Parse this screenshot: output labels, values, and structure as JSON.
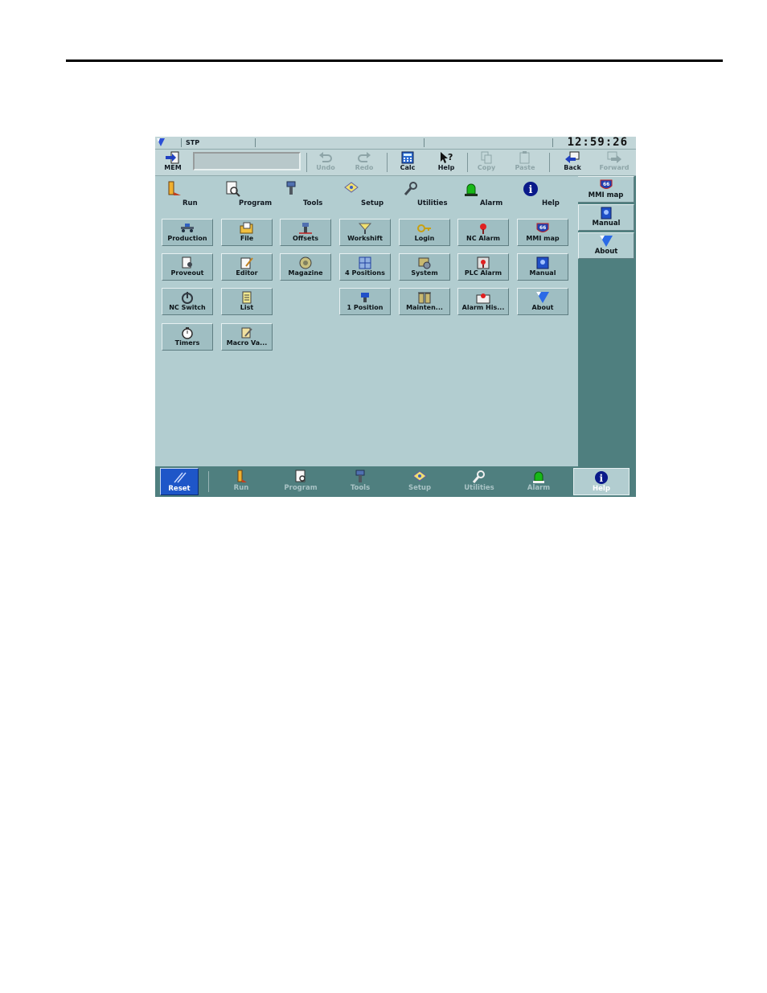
{
  "status": {
    "mode": "STP",
    "time": "12:59:26"
  },
  "toolbar": {
    "mem": "MEM",
    "undo": "Undo",
    "redo": "Redo",
    "calc": "Calc",
    "help": "Help",
    "copy": "Copy",
    "paste": "Paste",
    "back": "Back",
    "forward": "Forward"
  },
  "categories": [
    "Run",
    "Program",
    "Tools",
    "Setup",
    "Utilities",
    "Alarm",
    "Help"
  ],
  "grid": {
    "production": "Production",
    "file": "File",
    "offsets": "Offsets",
    "workshift": "Workshift",
    "login": "Login",
    "nc_alarm": "NC Alarm",
    "mmi_map": "MMI map",
    "proveout": "Proveout",
    "editor": "Editor",
    "magazine": "Magazine",
    "four_positions": "4 Positions",
    "system": "System",
    "plc_alarm": "PLC Alarm",
    "manual": "Manual",
    "nc_switch": "NC Switch",
    "list": "List",
    "one_position": "1 Position",
    "mainten": "Mainten...",
    "alarm_his": "Alarm His...",
    "about": "About",
    "timers": "Timers",
    "macro_va": "Macro Va..."
  },
  "right_panel": {
    "mmi_map": "MMI map",
    "manual": "Manual",
    "about": "About"
  },
  "bottom": {
    "reset": "Reset",
    "run": "Run",
    "program": "Program",
    "tools": "Tools",
    "setup": "Setup",
    "utilities": "Utilities",
    "alarm": "Alarm",
    "help": "Help"
  },
  "colors": {
    "screen_bg": "#b2cdd0",
    "panel_bg": "#4f7f7f",
    "reset_blue": "#1e56c8",
    "alarm_green": "#18b818"
  }
}
